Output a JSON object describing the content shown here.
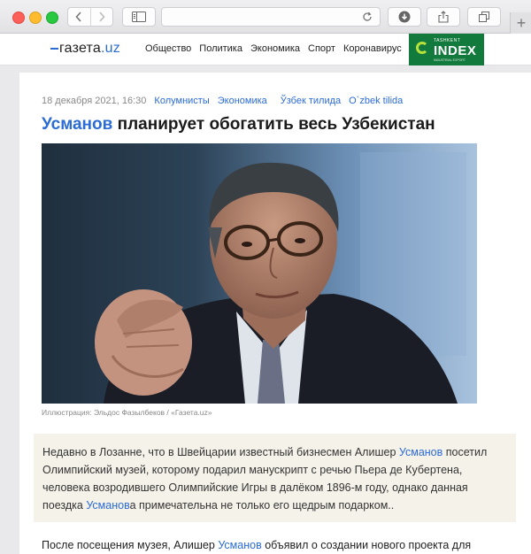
{
  "site": {
    "logo_main": "газета",
    "logo_tld": ".uz",
    "nav": [
      "Общество",
      "Политика",
      "Экономика",
      "Спорт",
      "Коронавирус"
    ],
    "banner": {
      "small": "TASHKENT",
      "big": "INDEX",
      "tiny": "INDUSTRIAL EXPORT"
    }
  },
  "article": {
    "date": "18 декабря 2021, 16:30",
    "tags": [
      "Колумнисты",
      "Экономика"
    ],
    "lang_links": [
      "Ўзбек тилида",
      "O`zbek tilida"
    ],
    "headline_name": "Усманов",
    "headline_rest": " планирует обогатить весь Узбекистан",
    "caption": "Иллюстрация: Эльдос Фазылбеков / «Газета.uz»",
    "lead_part1": "Недавно в Лозанне, что в Швейцарии известный бизнесмен Алишер ",
    "lead_name1": "Усманов",
    "lead_part2": " посетил Олимпийский музей, которому подарил манускрипт с речью Пьера де Кубертена, человека возродившего Олимпийские Игры в далёком 1896-м году, однако данная поездка ",
    "lead_name2": "Усманов",
    "lead_part3": "а примечательна не только его щедрым подарком..",
    "body_part1": "После посещения музея, Алишер ",
    "body_name": "Усманов",
    "body_part2": " объявил о создании нового проекта для"
  },
  "colors": {
    "accent": "#2b6bd6",
    "lead_bg": "#f5f2ea",
    "banner_bg": "#127a3d",
    "banner_ring": "#b6e23a"
  }
}
